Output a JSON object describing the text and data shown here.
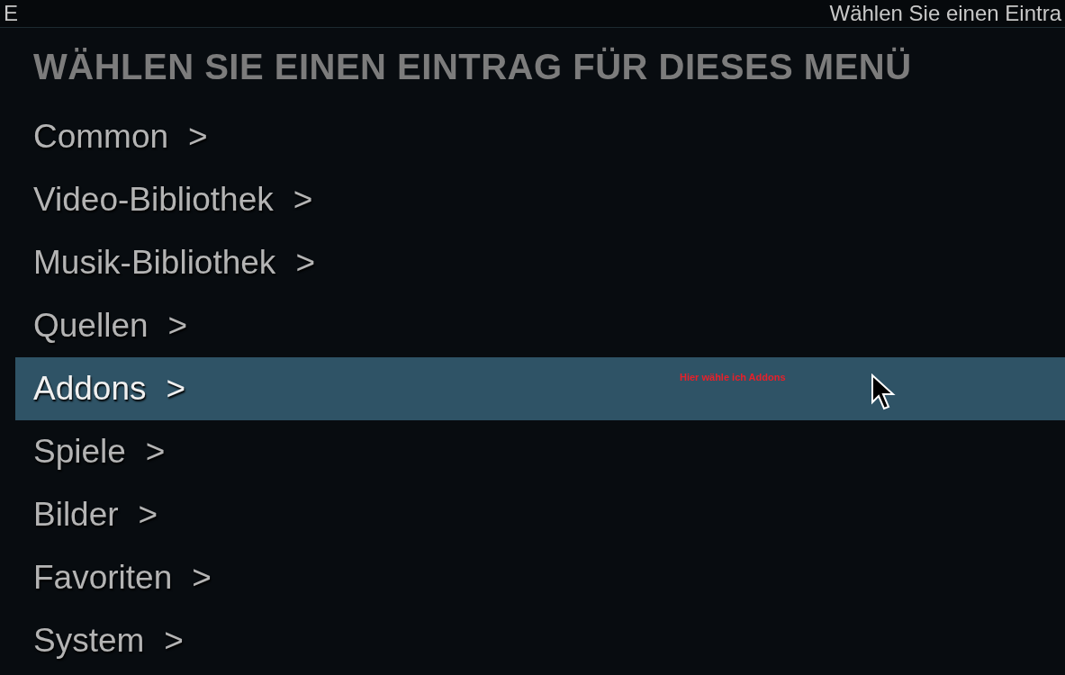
{
  "top_bar": {
    "left_text": "E",
    "title": "Wählen Sie einen Eintra"
  },
  "dialog": {
    "heading": "WÄHLEN SIE EINEN EINTRAG FÜR DIESES MENÜ",
    "items": [
      {
        "label": "Common",
        "arrow": ">",
        "selected": false
      },
      {
        "label": "Video-Bibliothek",
        "arrow": ">",
        "selected": false
      },
      {
        "label": "Musik-Bibliothek",
        "arrow": ">",
        "selected": false
      },
      {
        "label": "Quellen",
        "arrow": ">",
        "selected": false
      },
      {
        "label": "Addons",
        "arrow": ">",
        "selected": true
      },
      {
        "label": "Spiele",
        "arrow": ">",
        "selected": false
      },
      {
        "label": "Bilder",
        "arrow": ">",
        "selected": false
      },
      {
        "label": "Favoriten",
        "arrow": ">",
        "selected": false
      },
      {
        "label": "System",
        "arrow": ">",
        "selected": false
      }
    ]
  },
  "annotation": {
    "text": "Hier wähle ich Addons"
  }
}
